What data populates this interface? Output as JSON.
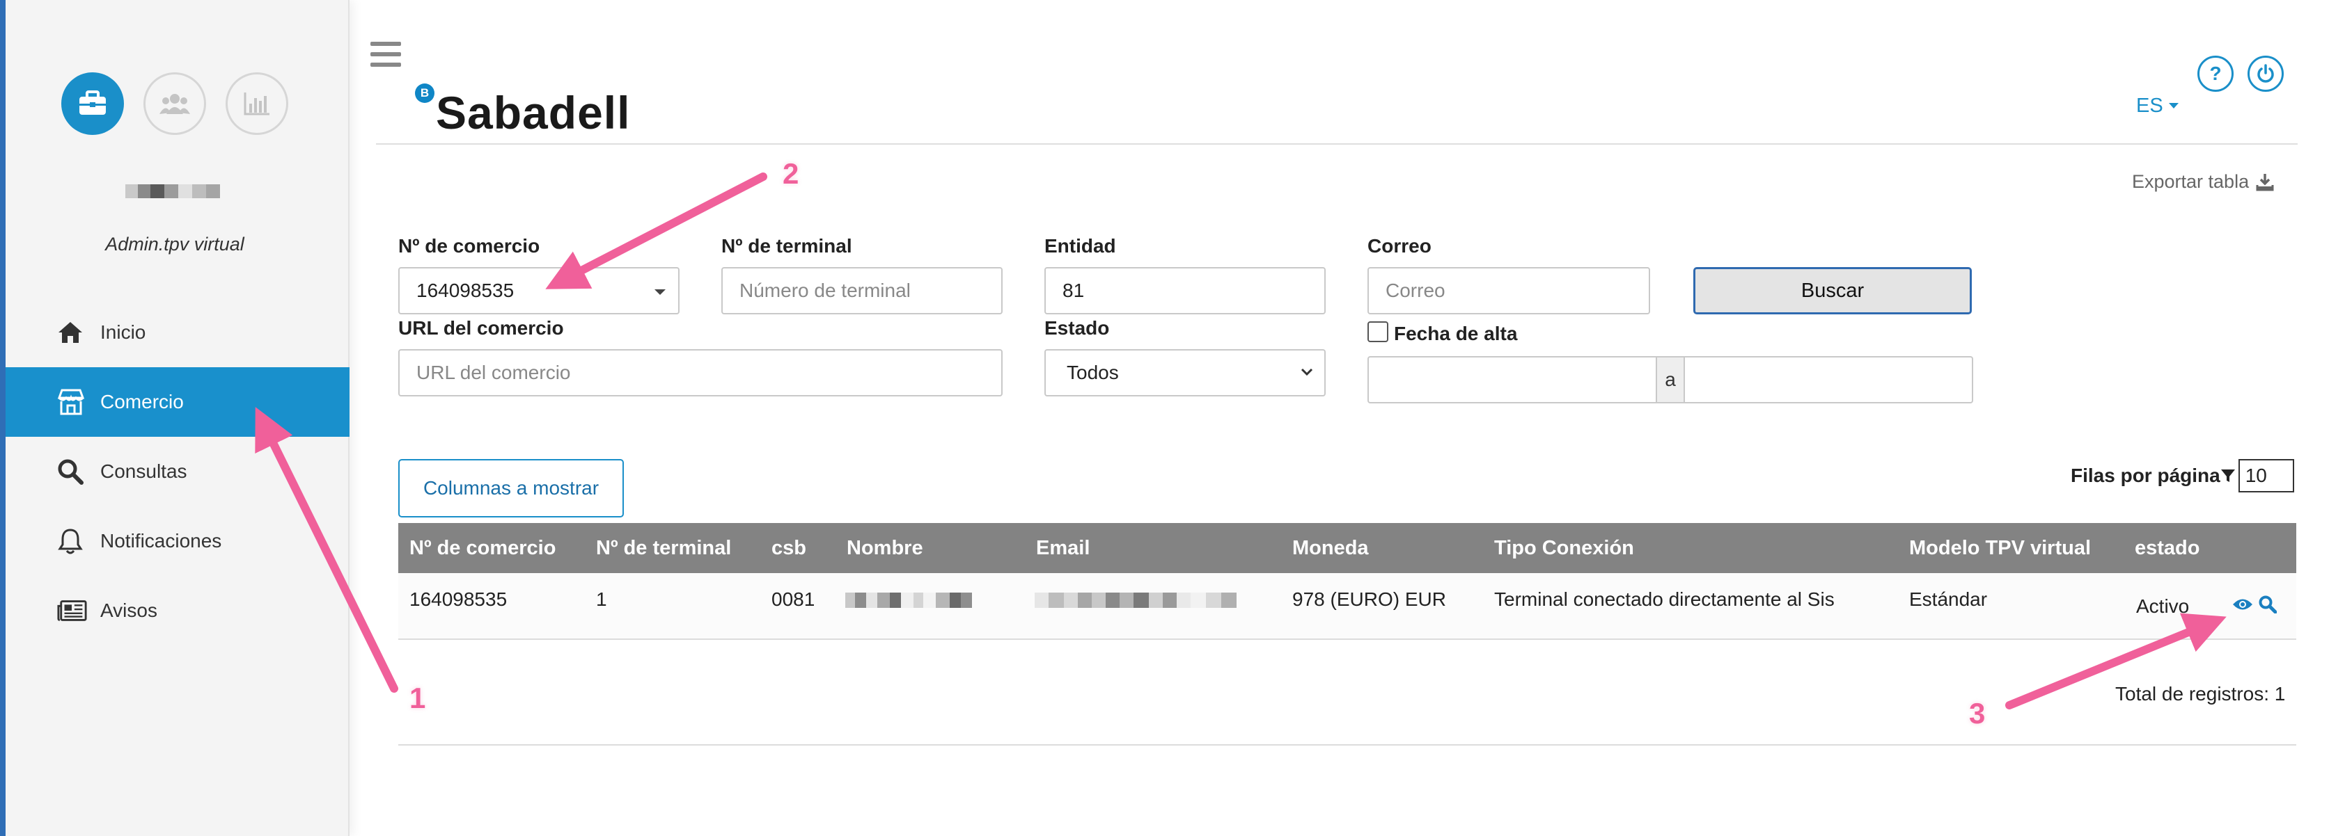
{
  "sidebar": {
    "top_icons": [
      "briefcase-icon",
      "users-icon",
      "bar-chart-icon"
    ],
    "user_role": "Admin.tpv virtual",
    "items": [
      {
        "label": "Inicio",
        "icon": "home-icon"
      },
      {
        "label": "Comercio",
        "icon": "store-icon",
        "active": true
      },
      {
        "label": "Consultas",
        "icon": "search-icon"
      },
      {
        "label": "Notificaciones",
        "icon": "bell-icon"
      },
      {
        "label": "Avisos",
        "icon": "newspaper-icon"
      }
    ]
  },
  "header": {
    "logo_badge": "B",
    "logo_text": "Sabadell",
    "help_label": "?",
    "language": "ES",
    "export_label": "Exportar tabla"
  },
  "filters": {
    "comercio": {
      "label": "Nº de comercio",
      "value": "164098535"
    },
    "terminal": {
      "label": "Nº de terminal",
      "placeholder": "Número de terminal"
    },
    "entidad": {
      "label": "Entidad",
      "value": "81"
    },
    "correo": {
      "label": "Correo",
      "placeholder": "Correo"
    },
    "buscar_label": "Buscar",
    "url": {
      "label": "URL del comercio",
      "placeholder": "URL del comercio"
    },
    "estado": {
      "label": "Estado",
      "value": "Todos"
    },
    "fecha_alta": {
      "label": "Fecha de alta",
      "separator": "a",
      "checked": false
    }
  },
  "table": {
    "columnas_label": "Columnas a mostrar",
    "rows_per_page_label": "Filas por página",
    "rows_per_page_value": "10",
    "headers": [
      "Nº de comercio",
      "Nº de terminal",
      "csb",
      "Nombre",
      "Email",
      "Moneda",
      "Tipo Conexión",
      "Modelo TPV virtual",
      "estado"
    ],
    "rows": [
      {
        "comercio": "164098535",
        "terminal": "1",
        "csb": "0081",
        "moneda": "978 (EURO) EUR",
        "tipo_conexion": "Terminal conectado directamente al Sis",
        "modelo": "Estándar",
        "estado": "Activo"
      }
    ],
    "total_label": "Total de registros: 1"
  },
  "annotations": {
    "arrow_color": "#f0609a",
    "labels": [
      "1",
      "2",
      "3"
    ]
  },
  "colors": {
    "accent": "#1a8fc9",
    "sidebar_active": "#1990cc",
    "table_header": "#838383"
  }
}
